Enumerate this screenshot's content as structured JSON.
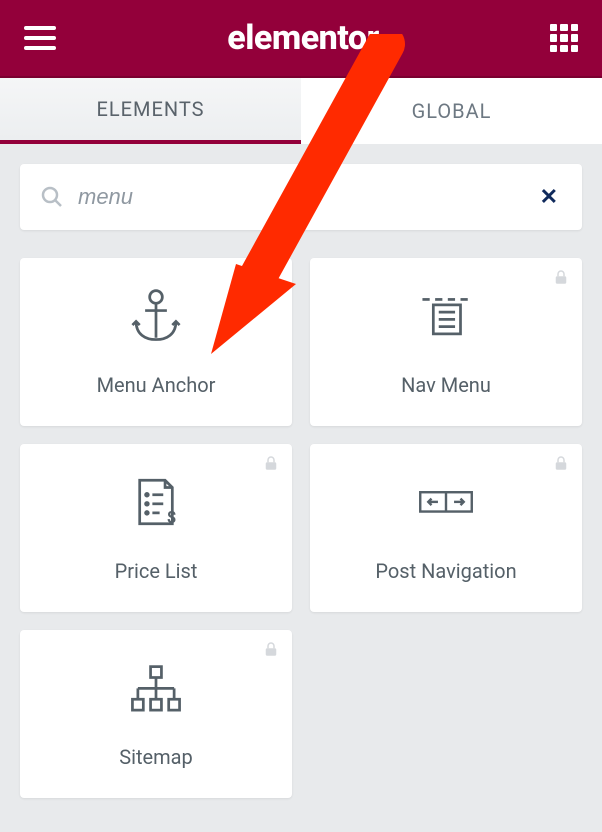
{
  "header": {
    "brand": "elementor"
  },
  "tabs": {
    "elements": "ELEMENTS",
    "global": "GLOBAL"
  },
  "search": {
    "value": "menu",
    "clear": "✕"
  },
  "widgets": [
    {
      "label": "Menu Anchor",
      "locked": false
    },
    {
      "label": "Nav Menu",
      "locked": true
    },
    {
      "label": "Price List",
      "locked": true
    },
    {
      "label": "Post Navigation",
      "locked": true
    },
    {
      "label": "Sitemap",
      "locked": true
    }
  ]
}
